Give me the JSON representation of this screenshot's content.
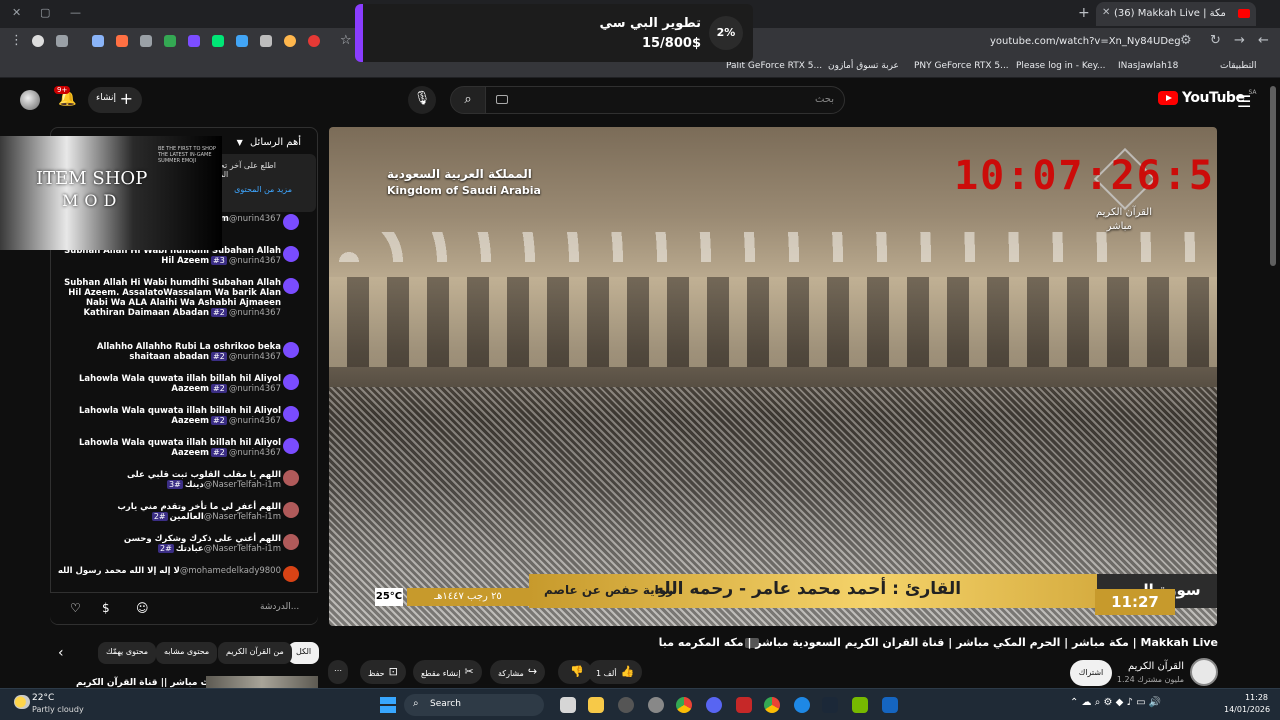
{
  "browser": {
    "tab_title": "Makkah Live | مكة ",
    "tab_count_badge": "(36)",
    "url": "youtube.com/watch?v=Xn_Ny84UDeg",
    "bookmarks": [
      "التطبيقات",
      "INasJawlah18",
      "Please log in - Key...",
      "PNY GeForce RTX 5...",
      "عربة تسوق أمازون",
      "Palit GeForce RTX 5..."
    ]
  },
  "notification": {
    "title": "تطوير البي سي",
    "amount": "15/800$",
    "percent": "2%"
  },
  "youtube": {
    "logo_text": "YouTube",
    "logo_region": "SA",
    "search_placeholder": "بحث",
    "create_label": "إنشاء",
    "notif_count": "9+"
  },
  "video": {
    "ksa_arabic": "المملكة العربية السعودية",
    "ksa_english": "Kingdom of Saudi Arabia",
    "clock": "10:07:26:57",
    "channel_ar": "القرآن الكريم",
    "channel_live": "مباشر",
    "surah": "سورة الروم",
    "reciter": "القارئ : أحمد محمد عامر - رحمه الله",
    "riwaya": "رواية حفص عن عاصم",
    "temperature": "25°C",
    "hijri": "٢٥ رجب ١٤٤٧هـ",
    "time": "11:27"
  },
  "chat": {
    "header": "أهم الرسائل",
    "pinned_text": "اطلع على آخر تحديثات المحتوى",
    "pinned_more": "مزيد من المحتوى",
    "input_placeholder": "الدردشة...",
    "messages": [
      {
        "author": "@nurin4367",
        "badge": "",
        "text": "Subhan Allah Hil Azeem",
        "color": "#7a4cff"
      },
      {
        "author": "@nurin4367",
        "badge": "#3",
        "text": "Subhan Allah Hi Wabi humdihi Subahan Allah Hil Azeem",
        "color": "#7a4cff"
      },
      {
        "author": "@nurin4367",
        "badge": "#2",
        "text": "Subhan Allah Hi Wabi humdihi Subahan Allah Hil Azeem. AssalatoWassalam Wa barik Alan Nabi Wa ALA Alaihi Wa Ashabhi Ajmaeen Kathiran Daimaan Abadan",
        "color": "#7a4cff"
      },
      {
        "author": "@nurin4367",
        "badge": "#2",
        "text": "Allahho Allahho Rubi La oshrikoo beka shaitaan abadan",
        "color": "#7a4cff"
      },
      {
        "author": "@nurin4367",
        "badge": "#2",
        "text": "Lahowla Wala quwata illah billah hil Aliyol Aazeem",
        "color": "#7a4cff"
      },
      {
        "author": "@nurin4367",
        "badge": "#2",
        "text": "Lahowla Wala quwata illah billah hil Aliyol Aazeem",
        "color": "#7a4cff"
      },
      {
        "author": "@nurin4367",
        "badge": "#2",
        "text": "Lahowla Wala quwata illah billah hil Aliyol Aazeem",
        "color": "#7a4cff"
      },
      {
        "author": "@NaserTelfah-i1m",
        "badge": "#3",
        "text": "اللهم يا مقلب القلوب ثبت قلبي على دينك",
        "color": "#b05a5a"
      },
      {
        "author": "@NaserTelfah-i1m",
        "badge": "#2",
        "text": "اللهم أعفر لي ما تأخر وتقدم مني يارب العالمين",
        "color": "#b05a5a"
      },
      {
        "author": "@NaserTelfah-i1m",
        "badge": "#2",
        "text": "اللهم أعني على ذكرك وشكرك وحسن عبادتك",
        "color": "#b05a5a"
      },
      {
        "author": "@mohamedelkady9800",
        "badge": "",
        "text": "لا إله إلا الله محمد رسول الله",
        "color": "#d84315"
      }
    ]
  },
  "overlay_banner": {
    "line1": "ITEM SHOP",
    "line2": "MOD",
    "small": "BE THE FIRST TO SHOP THE LATEST IN-GAME SUMMER EMOJI"
  },
  "meta": {
    "title": "مكة مباشر | الحرم المكي مباشر | قناة القران الكريم السعودية مباشر | مكه المكرمه مبا | Makkah Live",
    "channel_name": "القرآن الكريم",
    "subscribers": "1.24 مليون مشترك",
    "subscribe": "اشتراك",
    "likes": "1 ألف",
    "share": "مشاركة",
    "clip": "إنشاء مقطع",
    "save": "حفظ"
  },
  "chips": [
    "الكل",
    "من القرآن الكريم",
    "محتوى مشابه",
    "محتوى يهمّك"
  ],
  "related_title": "بث مباشر || قناة القرآن الكريم Makkah",
  "taskbar": {
    "weather_temp": "22°C",
    "weather_desc": "Partly cloudy",
    "search": "Search",
    "time": "11:28",
    "date": "14/01/2026"
  }
}
